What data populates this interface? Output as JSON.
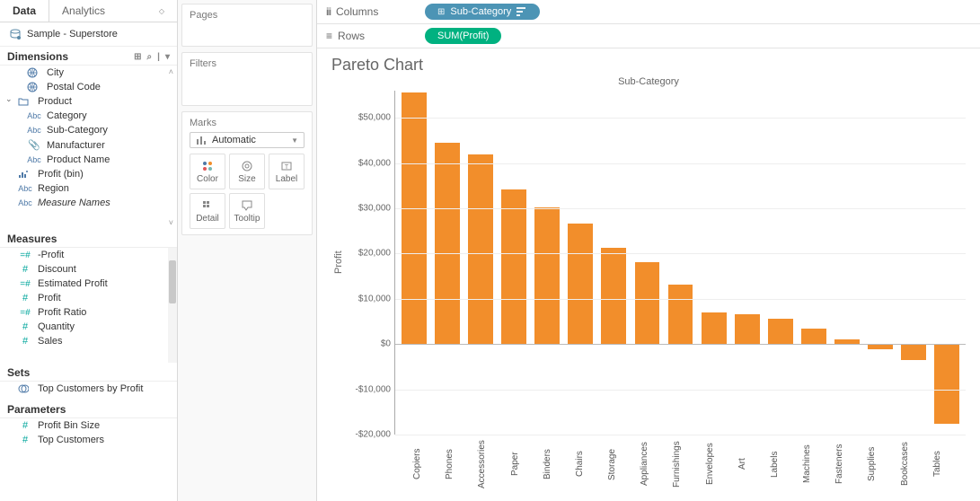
{
  "tabs": {
    "data": "Data",
    "analytics": "Analytics"
  },
  "data_source": "Sample - Superstore",
  "dimensions": {
    "label": "Dimensions",
    "items": [
      {
        "icon": "globe",
        "label": "City",
        "indent": 1
      },
      {
        "icon": "globe",
        "label": "Postal Code",
        "indent": 1
      },
      {
        "icon": "folder",
        "label": "Product",
        "indent": 0,
        "expanded": true
      },
      {
        "icon": "abc",
        "label": "Category",
        "indent": 1
      },
      {
        "icon": "abc",
        "label": "Sub-Category",
        "indent": 1
      },
      {
        "icon": "clip",
        "label": "Manufacturer",
        "indent": 1
      },
      {
        "icon": "abc",
        "label": "Product Name",
        "indent": 1
      },
      {
        "icon": "bin",
        "label": "Profit (bin)",
        "indent": 0
      },
      {
        "icon": "abc",
        "label": "Region",
        "indent": 0
      },
      {
        "icon": "abc",
        "label": "Measure Names",
        "indent": 0,
        "italic": true
      }
    ]
  },
  "measures": {
    "label": "Measures",
    "items": [
      {
        "icon": "calc",
        "label": "-Profit"
      },
      {
        "icon": "hash",
        "label": "Discount"
      },
      {
        "icon": "calc",
        "label": "Estimated Profit"
      },
      {
        "icon": "hash",
        "label": "Profit"
      },
      {
        "icon": "calc",
        "label": "Profit Ratio"
      },
      {
        "icon": "hash",
        "label": "Quantity"
      },
      {
        "icon": "hash",
        "label": "Sales"
      }
    ]
  },
  "sets": {
    "label": "Sets",
    "items": [
      {
        "icon": "set",
        "label": "Top Customers by Profit"
      }
    ]
  },
  "parameters": {
    "label": "Parameters",
    "items": [
      {
        "icon": "hash",
        "label": "Profit Bin Size"
      },
      {
        "icon": "hash",
        "label": "Top Customers"
      }
    ]
  },
  "cards": {
    "pages": "Pages",
    "filters": "Filters",
    "marks": "Marks",
    "mark_type": "Automatic",
    "mark_buttons": {
      "color": "Color",
      "size": "Size",
      "label": "Label",
      "detail": "Detail",
      "tooltip": "Tooltip"
    }
  },
  "shelves": {
    "columns": "Columns",
    "rows": "Rows",
    "columns_pill": "Sub-Category",
    "rows_pill": "SUM(Profit)"
  },
  "viz": {
    "title": "Pareto Chart",
    "x_title": "Sub-Category",
    "y_title": "Profit"
  },
  "chart_data": {
    "type": "bar",
    "title": "Pareto Chart",
    "xlabel": "Sub-Category",
    "ylabel": "Profit",
    "ylim": [
      -20000,
      56000
    ],
    "y_ticks": [
      -20000,
      -10000,
      0,
      10000,
      20000,
      30000,
      40000,
      50000
    ],
    "y_tick_labels": [
      "-$20,000",
      "-$10,000",
      "$0",
      "$10,000",
      "$20,000",
      "$30,000",
      "$40,000",
      "$50,000"
    ],
    "categories": [
      "Copiers",
      "Phones",
      "Accessories",
      "Paper",
      "Binders",
      "Chairs",
      "Storage",
      "Appliances",
      "Furnishings",
      "Envelopes",
      "Art",
      "Labels",
      "Machines",
      "Fasteners",
      "Supplies",
      "Bookcases",
      "Tables"
    ],
    "values": [
      55600,
      44500,
      41900,
      34100,
      30200,
      26600,
      21300,
      18100,
      13100,
      7000,
      6600,
      5500,
      3400,
      950,
      -1200,
      -3500,
      -17700
    ],
    "bar_color": "#f28e2b"
  }
}
